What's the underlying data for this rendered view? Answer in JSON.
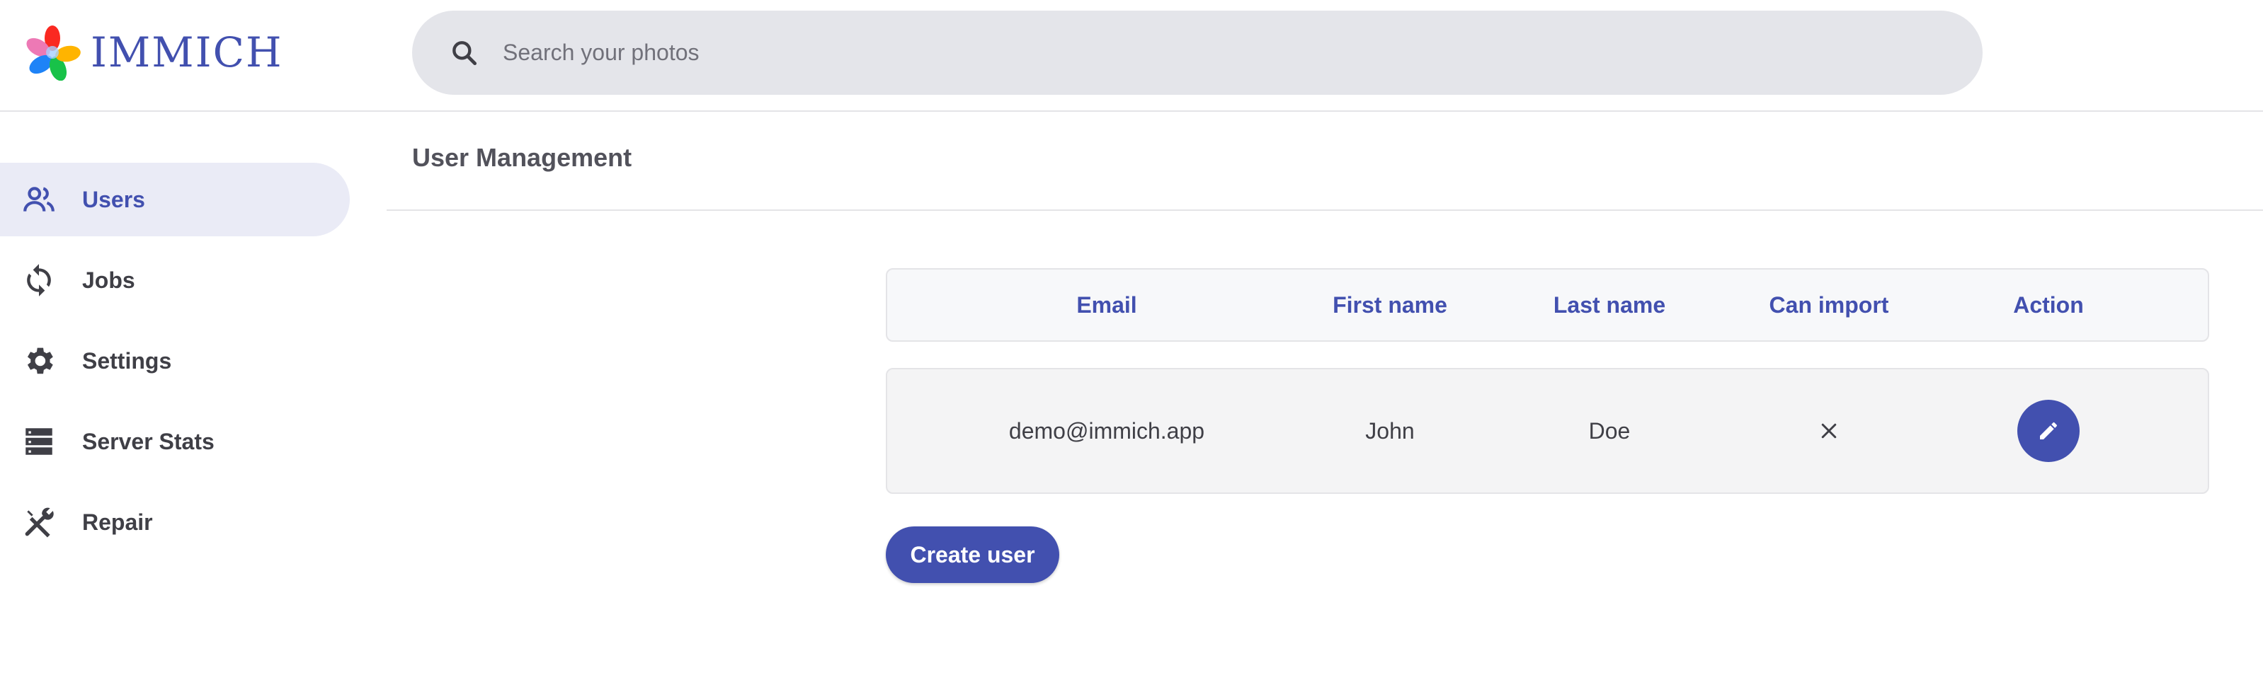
{
  "app": {
    "name": "IMMICH"
  },
  "search": {
    "placeholder": "Search your photos",
    "icon": "search-icon"
  },
  "sidebar": {
    "items": [
      {
        "label": "Users",
        "icon": "users-icon",
        "active": true
      },
      {
        "label": "Jobs",
        "icon": "sync-icon",
        "active": false
      },
      {
        "label": "Settings",
        "icon": "gear-icon",
        "active": false
      },
      {
        "label": "Server Stats",
        "icon": "server-icon",
        "active": false
      },
      {
        "label": "Repair",
        "icon": "tools-icon",
        "active": false
      }
    ]
  },
  "main": {
    "title": "User Management",
    "table": {
      "columns": [
        "Email",
        "First name",
        "Last name",
        "Can import",
        "Action"
      ],
      "rows": [
        {
          "email": "demo@immich.app",
          "first_name": "John",
          "last_name": "Doe",
          "can_import": "no",
          "action": "edit"
        }
      ]
    },
    "create_button": "Create user"
  },
  "colors": {
    "accent": "#4250af",
    "nav_active_bg": "#eaebf6",
    "search_bg": "#e4e5ea",
    "row_bg": "#f4f4f5",
    "header_bg": "#f7f8fa"
  }
}
